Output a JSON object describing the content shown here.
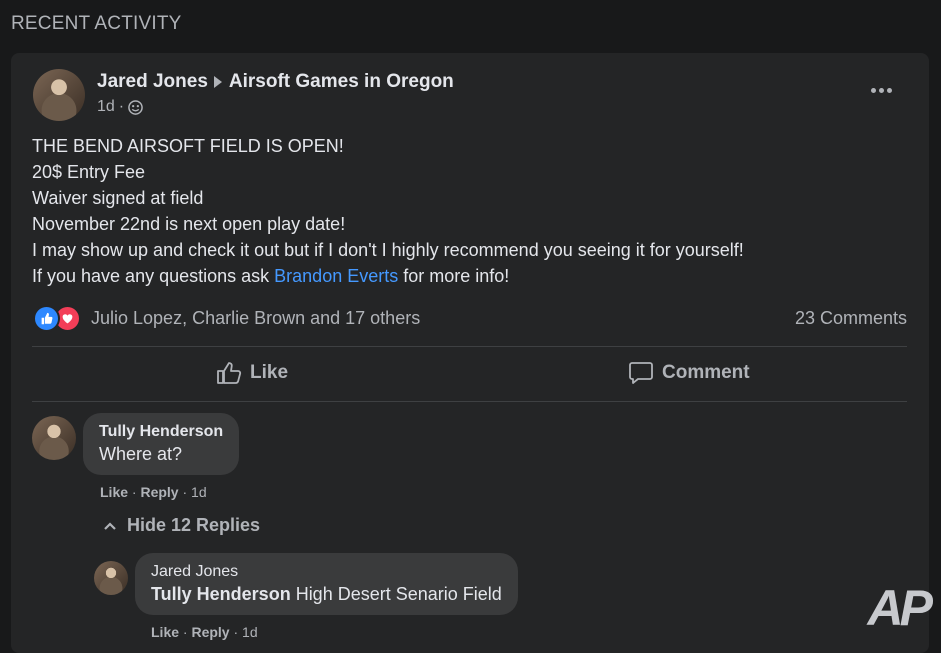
{
  "section": {
    "title": "RECENT ACTIVITY"
  },
  "post": {
    "author": "Jared Jones",
    "group": "Airsoft Games in Oregon",
    "time": "1d",
    "separator": "·",
    "body_lines": [
      "THE BEND AIRSOFT FIELD IS OPEN!",
      "20$ Entry Fee",
      "Waiver signed at field",
      "November 22nd is next open play date!",
      "I may show up and check it out but if I don't I highly recommend you seeing it for yourself!"
    ],
    "last_line_prefix": "If you have any questions ask ",
    "mention": "Brandon Everts",
    "last_line_suffix": " for more info!",
    "reactions_text": "Julio Lopez, Charlie Brown and 17 others",
    "comments_count": "23 Comments",
    "like_label": "Like",
    "comment_label": "Comment"
  },
  "comments": [
    {
      "name": "Tully Henderson",
      "text": "Where at?",
      "like": "Like",
      "reply": "Reply",
      "time": "1d"
    }
  ],
  "replies_toggle": "Hide 12 Replies",
  "reply": {
    "name": "Jared Jones",
    "mention": "Tully Henderson",
    "text": " High Desert Senario Field",
    "like": "Like",
    "reply": "Reply",
    "time": "1d"
  },
  "watermark": "AP",
  "colors": {
    "like_blue": "#2d88ff",
    "love_red": "#f33e58",
    "link": "#4599ff"
  }
}
